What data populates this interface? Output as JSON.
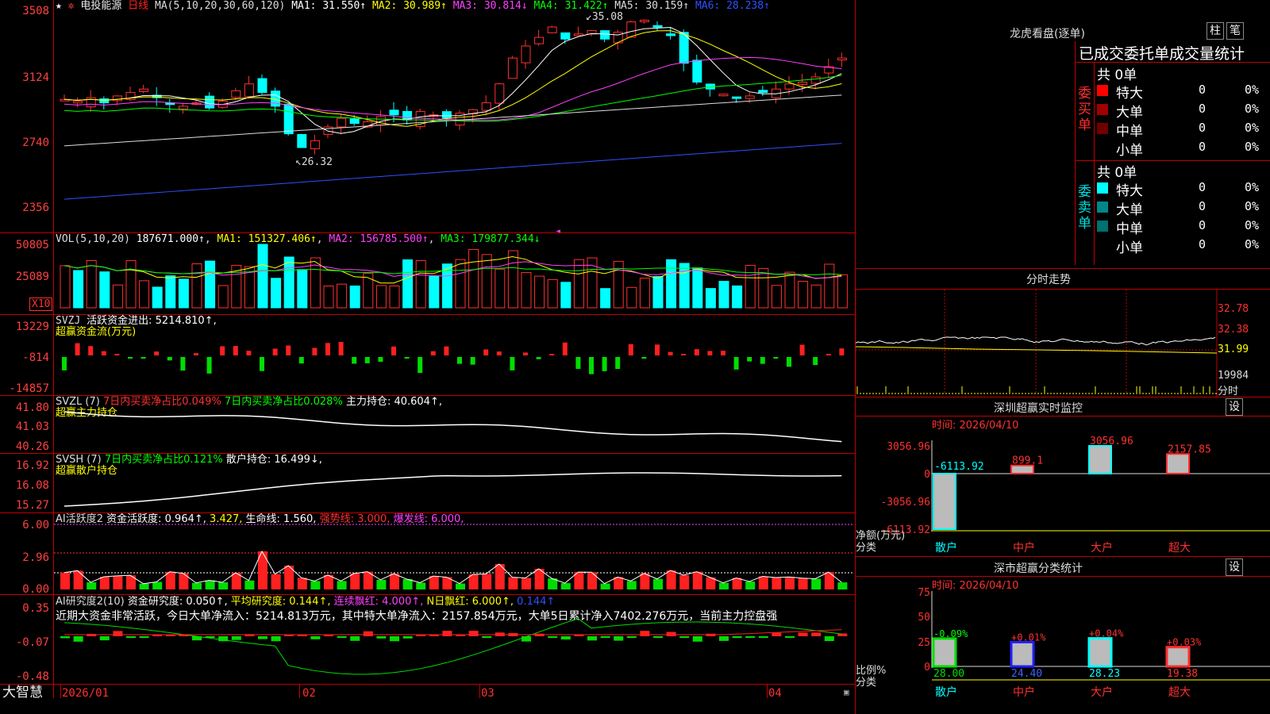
{
  "main": {
    "stock_name": "电投能源",
    "period": "日线",
    "ma_title": "MA(5,10,20,30,60,120)",
    "ma_items": [
      {
        "label": "MA1: 31.550↑",
        "color": "#ffffff"
      },
      {
        "label": "MA2: 30.989↑",
        "color": "#ffff00"
      },
      {
        "label": "MA3: 30.814↓",
        "color": "#ff40ff"
      },
      {
        "label": "MA4: 31.422↑",
        "color": "#00ff00"
      },
      {
        "label": "MA5: 30.159↑",
        "color": "#dddddd"
      },
      {
        "label": "MA6: 28.238↑",
        "color": "#3050ff"
      }
    ],
    "y_labels": [
      "3508",
      "3124",
      "2740",
      "2356"
    ],
    "annot_high": "35.08",
    "annot_low": "26.32"
  },
  "vol": {
    "title": "VOL(5,10,20)",
    "value": "187671.000↑",
    "ma1": "MA1: 151327.406↑",
    "ma2": "MA2: 156785.500↑",
    "ma3": "MA3: 179877.344↓",
    "y_labels": [
      "50805",
      "25089"
    ],
    "unit": "X10"
  },
  "svzj": {
    "title": "SVZJ",
    "label1": "活跃资金进出: 5214.810↑,",
    "label2": "超赢资金流(万元)",
    "y_labels": [
      "13229",
      "-814",
      "-14857"
    ]
  },
  "svzl": {
    "title": "SVZL (7)",
    "red_text": "7日内买卖净占比0.049%",
    "green_text": "7日内买卖净占比0.028%",
    "main_text": "主力持仓: 40.604↑,",
    "label2": "超赢主力持仓",
    "y_labels": [
      "41.80",
      "41.03",
      "40.26"
    ]
  },
  "svsh": {
    "title": "SVSH (7)",
    "green_text": "7日内买卖净占比0.121%",
    "main_text": "散户持仓: 16.499↓,",
    "label2": "超赢散户持仓",
    "y_labels": [
      "16.92",
      "16.08",
      "15.27"
    ]
  },
  "ai1": {
    "title": "AI活跃度2",
    "t1": "资金活跃度: 0.964↑,",
    "t2": "3.427,",
    "t3": "生命线: 1.560,",
    "t4": "强势线: 3.000,",
    "t5": "爆发线: 6.000,",
    "y_labels": [
      "6.00",
      "2.96",
      "0.00"
    ]
  },
  "ai2": {
    "title": "AI研究度2(10)",
    "t1": "资金研究度: 0.050↑,",
    "t2": "平均研究度: 0.144↑,",
    "t3": "连续飘红: 4.000↑,",
    "t4": "N日飘红: 6.000↑,",
    "t5": "0.144↑",
    "summary": "近期大资金非常活跃，今日大单净流入：5214.813万元，其中特大单净流入：2157.854万元，大单5日累计净入7402.276万元，当前主力控盘强",
    "y_labels": [
      "0.35",
      "-0.07",
      "-0.48"
    ]
  },
  "bottom": {
    "brand": "大智慧",
    "dates": [
      "2026/01",
      "02",
      "03",
      "04"
    ]
  },
  "right": {
    "dragon_title": "龙虎看盘(逐单)",
    "btn_zhu": "柱",
    "btn_bi": "笔",
    "header": "已成交委托单成交量统计",
    "buy_total": "共 0单",
    "sell_total": "共 0单",
    "buy_side": [
      "委",
      "买",
      "单"
    ],
    "sell_side": [
      "委",
      "卖",
      "单"
    ],
    "buy_rows": [
      {
        "name": "特大",
        "val": "0",
        "pct": "0%",
        "color": "#ff0000"
      },
      {
        "name": "大单",
        "val": "0",
        "pct": "0%",
        "color": "#a00000"
      },
      {
        "name": "中单",
        "val": "0",
        "pct": "0%",
        "color": "#700000"
      },
      {
        "name": "小单",
        "val": "0",
        "pct": "0%",
        "color": ""
      }
    ],
    "sell_rows": [
      {
        "name": "特大",
        "val": "0",
        "pct": "0%",
        "color": "#00ffff"
      },
      {
        "name": "大单",
        "val": "0",
        "pct": "0%",
        "color": "#008888"
      },
      {
        "name": "中单",
        "val": "0",
        "pct": "0%",
        "color": "#007070"
      },
      {
        "name": "小单",
        "val": "0",
        "pct": "0%",
        "color": ""
      }
    ],
    "intraday_title": "分时走势",
    "intraday_labels": [
      "32.78",
      "32.38",
      "31.99",
      "19984"
    ],
    "intraday_unit": "分时",
    "sz_title": "深圳超赢实时监控",
    "btn_set": "设",
    "sz_time": "时间: 2026/04/10",
    "sz_y": [
      "3056.96",
      "0",
      "-3056.96",
      "-6113.92"
    ],
    "sz_unit1": "净额(万元)",
    "sz_unit2": "分类",
    "sz_cats": [
      "散户",
      "中户",
      "大户",
      "超大"
    ],
    "sz_values": [
      -6113.92,
      899.1,
      3056.96,
      2157.85
    ],
    "sz_value_labels": [
      "-6113.92",
      "899.1",
      "3056.96",
      "2157.85"
    ],
    "cls_title": "深市超赢分类统计",
    "cls_time": "时间: 2026/04/10",
    "cls_y": [
      "75",
      "50",
      "25",
      "0"
    ],
    "cls_unit1": "比例%",
    "cls_unit2": "分类",
    "cls_cats": [
      "散户",
      "中户",
      "大户",
      "超大"
    ],
    "cls_values": [
      28.0,
      24.4,
      28.23,
      19.38
    ],
    "cls_value_labels": [
      "28.00",
      "24.40",
      "28.23",
      "19.38"
    ],
    "cls_changes": [
      "-0.09%",
      "+0.01%",
      "+0.04%",
      "+0.03%"
    ]
  }
}
